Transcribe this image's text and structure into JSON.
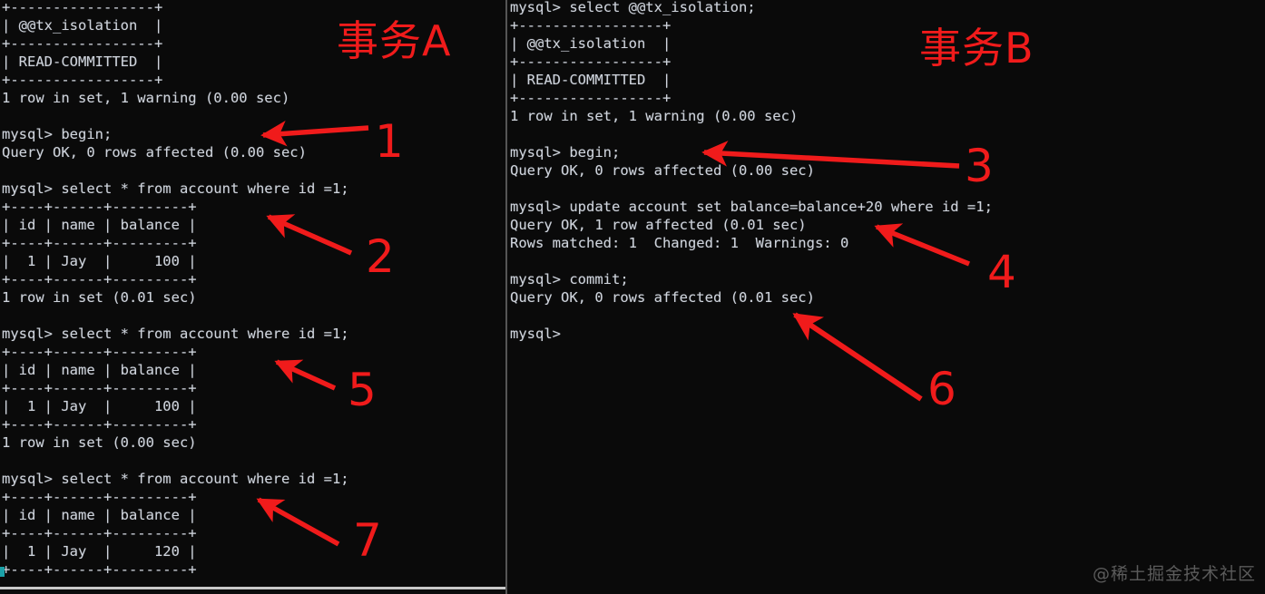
{
  "annotations": {
    "transaction_a_label": "事务A",
    "transaction_b_label": "事务B",
    "accent_color": "#f01b1b",
    "steps": [
      {
        "number": "1"
      },
      {
        "number": "2"
      },
      {
        "number": "3"
      },
      {
        "number": "4"
      },
      {
        "number": "5"
      },
      {
        "number": "6"
      },
      {
        "number": "7"
      }
    ]
  },
  "watermark": "@稀土掘金技术社区",
  "terminal_a": {
    "lines": [
      "+-----------------+",
      "| @@tx_isolation  |",
      "+-----------------+",
      "| READ-COMMITTED  |",
      "+-----------------+",
      "1 row in set, 1 warning (0.00 sec)",
      "",
      "mysql> begin;",
      "Query OK, 0 rows affected (0.00 sec)",
      "",
      "mysql> select * from account where id =1;",
      "+----+------+---------+",
      "| id | name | balance |",
      "+----+------+---------+",
      "|  1 | Jay  |     100 |",
      "+----+------+---------+",
      "1 row in set (0.01 sec)",
      "",
      "mysql> select * from account where id =1;",
      "+----+------+---------+",
      "| id | name | balance |",
      "+----+------+---------+",
      "|  1 | Jay  |     100 |",
      "+----+------+---------+",
      "1 row in set (0.00 sec)",
      "",
      "mysql> select * from account where id =1;",
      "+----+------+---------+",
      "| id | name | balance |",
      "+----+------+---------+",
      "|  1 | Jay  |     120 |",
      "+----+------+---------+"
    ]
  },
  "terminal_b": {
    "lines": [
      "mysql> select @@tx_isolation;",
      "+-----------------+",
      "| @@tx_isolation  |",
      "+-----------------+",
      "| READ-COMMITTED  |",
      "+-----------------+",
      "1 row in set, 1 warning (0.00 sec)",
      "",
      "mysql> begin;",
      "Query OK, 0 rows affected (0.00 sec)",
      "",
      "mysql> update account set balance=balance+20 where id =1;",
      "Query OK, 1 row affected (0.01 sec)",
      "Rows matched: 1  Changed: 1  Warnings: 0",
      "",
      "mysql> commit;",
      "Query OK, 0 rows affected (0.01 sec)",
      "",
      "mysql>"
    ]
  }
}
